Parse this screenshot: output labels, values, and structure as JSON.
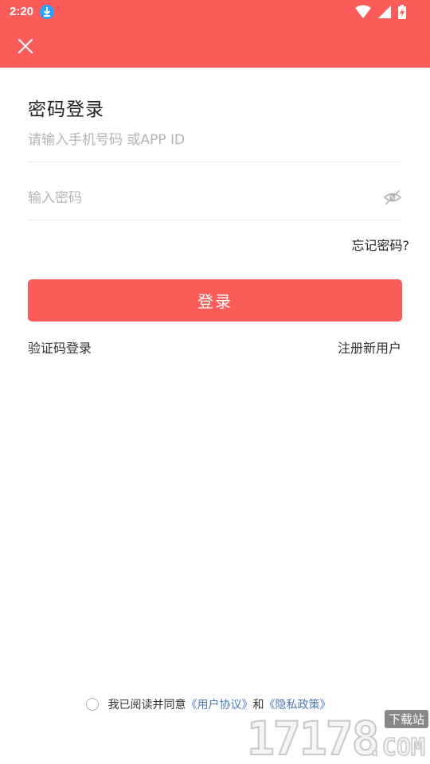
{
  "status_bar": {
    "time": "2:20",
    "icons": [
      "download-icon",
      "wifi-icon",
      "signal-icon",
      "battery-charging-icon"
    ]
  },
  "header": {
    "close_icon": "close-icon",
    "color": "#fb5c5a"
  },
  "login": {
    "title": "密码登录",
    "phone_placeholder": "请输入手机号码 或APP ID",
    "phone_value": "",
    "password_placeholder": "输入密码",
    "password_value": "",
    "password_toggle_icon": "eye-hidden-icon",
    "forgot_label": "忘记密码?",
    "submit_label": "登录",
    "sms_login_label": "验证码登录",
    "register_label": "注册新用户"
  },
  "agreement": {
    "prefix": "我已阅读并同意",
    "user_agreement": "《用户协议》",
    "and": "和",
    "privacy_policy": "《隐私政策》",
    "checked": false
  },
  "watermark": {
    "number": "17178",
    "tag": "下载站",
    "suffix": ".COM"
  },
  "colors": {
    "accent": "#fb5c5a",
    "link": "#4a79b8",
    "placeholder": "#b4b4b4"
  }
}
